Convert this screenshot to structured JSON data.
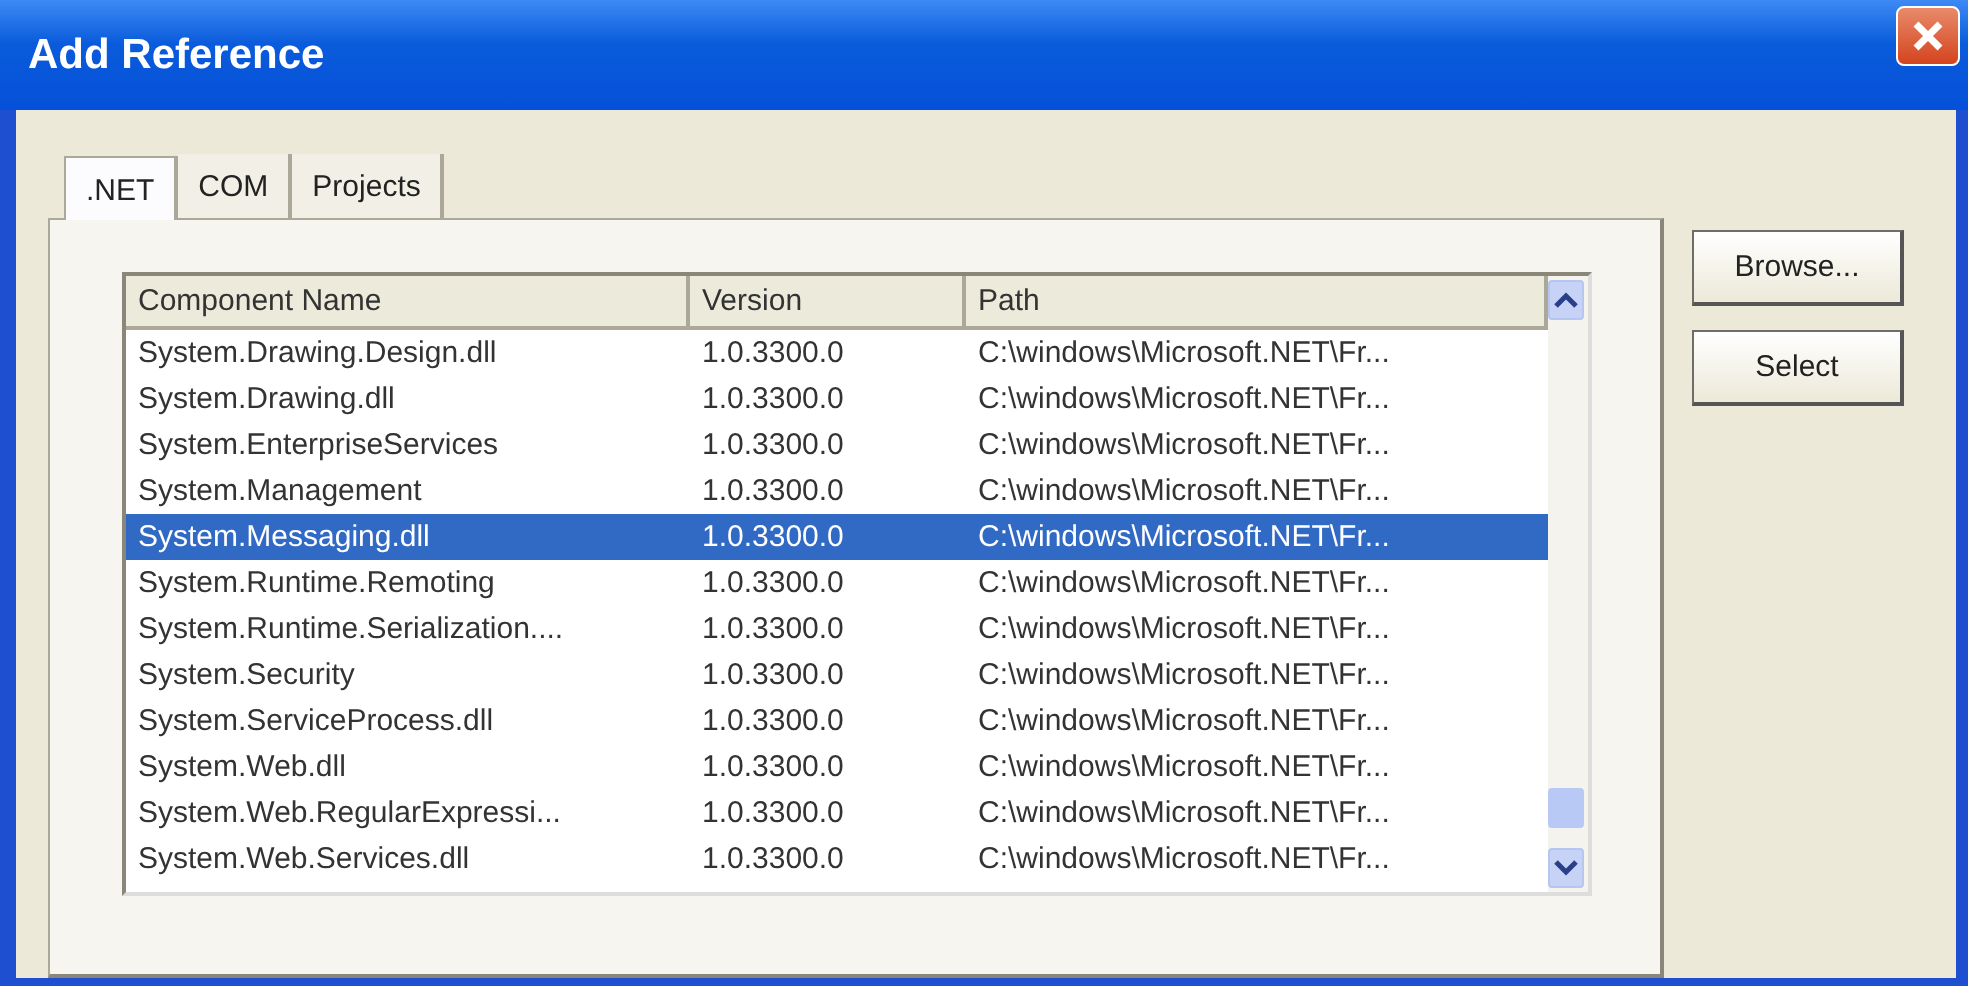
{
  "window": {
    "title": "Add Reference"
  },
  "tabs": [
    {
      "label": ".NET",
      "selected": true
    },
    {
      "label": "COM",
      "selected": false
    },
    {
      "label": "Projects",
      "selected": false
    }
  ],
  "table": {
    "columns": [
      "Component Name",
      "Version",
      "Path"
    ],
    "rows": [
      {
        "cells": [
          "System.Drawing.Design.dll",
          "1.0.3300.0",
          "C:\\windows\\Microsoft.NET\\Fr..."
        ],
        "selected": false
      },
      {
        "cells": [
          "System.Drawing.dll",
          "1.0.3300.0",
          "C:\\windows\\Microsoft.NET\\Fr..."
        ],
        "selected": false
      },
      {
        "cells": [
          "System.EnterpriseServices",
          "1.0.3300.0",
          "C:\\windows\\Microsoft.NET\\Fr..."
        ],
        "selected": false
      },
      {
        "cells": [
          "System.Management",
          "1.0.3300.0",
          "C:\\windows\\Microsoft.NET\\Fr..."
        ],
        "selected": false
      },
      {
        "cells": [
          "System.Messaging.dll",
          "1.0.3300.0",
          "C:\\windows\\Microsoft.NET\\Fr..."
        ],
        "selected": true
      },
      {
        "cells": [
          "System.Runtime.Remoting",
          "1.0.3300.0",
          "C:\\windows\\Microsoft.NET\\Fr..."
        ],
        "selected": false
      },
      {
        "cells": [
          "System.Runtime.Serialization....",
          "1.0.3300.0",
          "C:\\windows\\Microsoft.NET\\Fr..."
        ],
        "selected": false
      },
      {
        "cells": [
          "System.Security",
          "1.0.3300.0",
          "C:\\windows\\Microsoft.NET\\Fr..."
        ],
        "selected": false
      },
      {
        "cells": [
          "System.ServiceProcess.dll",
          "1.0.3300.0",
          "C:\\windows\\Microsoft.NET\\Fr..."
        ],
        "selected": false
      },
      {
        "cells": [
          "System.Web.dll",
          "1.0.3300.0",
          "C:\\windows\\Microsoft.NET\\Fr..."
        ],
        "selected": false
      },
      {
        "cells": [
          "System.Web.RegularExpressi...",
          "1.0.3300.0",
          "C:\\windows\\Microsoft.NET\\Fr..."
        ],
        "selected": false
      },
      {
        "cells": [
          "System.Web.Services.dll",
          "1.0.3300.0",
          "C:\\windows\\Microsoft.NET\\Fr..."
        ],
        "selected": false
      }
    ]
  },
  "buttons": [
    "Browse...",
    "Select"
  ]
}
